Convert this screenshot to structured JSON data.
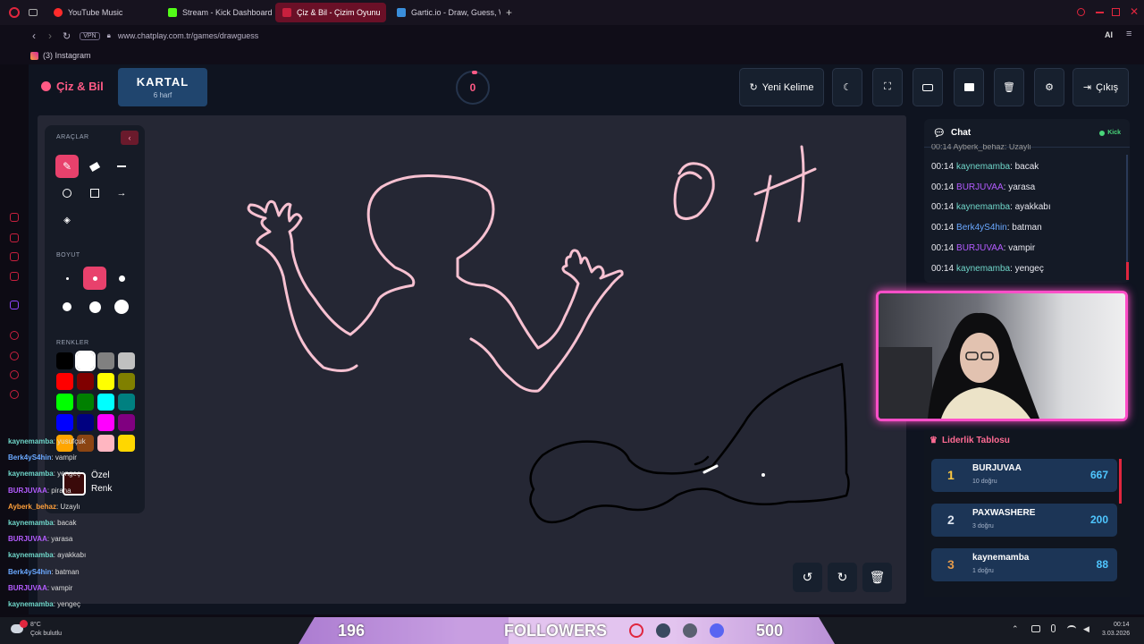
{
  "browser": {
    "tabs": [
      {
        "label": "YouTube Music",
        "color": "#ff2b2b"
      },
      {
        "label": "Stream - Kick Dashboard",
        "color": "#53fc18"
      },
      {
        "label": "Çiz & Bil - Çizim Oyunu",
        "color": "#c8203e"
      },
      {
        "label": "Gartic.io - Draw, Guess, W",
        "color": "#3a8edb"
      }
    ],
    "vpn": "VPN",
    "url": "www.chatplay.com.tr/games/drawguess",
    "bookmark": "(3) Instagram",
    "ai_label": "AI"
  },
  "app": {
    "logo": "Çiz & Bil",
    "word": "KARTAL",
    "word_hint": "6 harf",
    "timer": "0",
    "buttons": {
      "new_word": "Yeni Kelime",
      "exit": "Çıkış"
    }
  },
  "tools": {
    "section_tools": "ARAÇLAR",
    "section_size": "BOYUT",
    "section_colors": "RENKLER",
    "custom_color": "Özel",
    "custom_color2": "Renk",
    "colors": [
      "#000000",
      "#ffffff",
      "#808080",
      "#c0c0c0",
      "#ff0000",
      "#800000",
      "#ffff00",
      "#808000",
      "#00ff00",
      "#008000",
      "#00ffff",
      "#008080",
      "#0000ff",
      "#000080",
      "#ff00ff",
      "#800080",
      "#ffa500",
      "#8b4513",
      "#ffb6c1",
      "#ffd700"
    ]
  },
  "chat": {
    "title": "Chat",
    "badge": "Kick",
    "partial": "00:14 Ayberk_behaz: Uzaylı",
    "messages": [
      {
        "time": "00:14",
        "user": "kaynemamba",
        "text": "bacak",
        "color": "#6fd6c9"
      },
      {
        "time": "00:14",
        "user": "BURJUVAA",
        "text": "yarasa",
        "color": "#b45cff"
      },
      {
        "time": "00:14",
        "user": "kaynemamba",
        "text": "ayakkabı",
        "color": "#6fd6c9"
      },
      {
        "time": "00:14",
        "user": "Berk4yS4hin",
        "text": "batman",
        "color": "#6aa8ff"
      },
      {
        "time": "00:14",
        "user": "BURJUVAA",
        "text": "vampir",
        "color": "#b45cff"
      },
      {
        "time": "00:14",
        "user": "kaynemamba",
        "text": "yengeç",
        "color": "#6fd6c9"
      }
    ]
  },
  "leaderboard": {
    "title": "Liderlik Tablosu",
    "rows": [
      {
        "rank": "1",
        "name": "BURJUVAA",
        "correct": "10 doğru",
        "points": "667",
        "rank_color": "#ffc940"
      },
      {
        "rank": "2",
        "name": "PAXWASHERE",
        "correct": "3 doğru",
        "points": "200",
        "rank_color": "#dfe6f0"
      },
      {
        "rank": "3",
        "name": "kaynemamba",
        "correct": "1 doğru",
        "points": "88",
        "rank_color": "#e39a4b"
      }
    ]
  },
  "overlay_chat": [
    {
      "user": "kaynemamba",
      "text": ": yusufçuk",
      "color": "#6fd6c9"
    },
    {
      "user": "Berk4yS4hin",
      "text": ": vampir",
      "color": "#6aa8ff"
    },
    {
      "user": "kaynemamba",
      "text": ": yengeç",
      "color": "#6fd6c9"
    },
    {
      "user": "BURJUVAA",
      "text": ": pirana",
      "color": "#b45cff"
    },
    {
      "user": "Ayberk_behaz",
      "text": ": Uzaylı",
      "color": "#ff9f3a"
    },
    {
      "user": "kaynemamba",
      "text": ": bacak",
      "color": "#6fd6c9"
    },
    {
      "user": "BURJUVAA",
      "text": ": yarasa",
      "color": "#b45cff"
    },
    {
      "user": "kaynemamba",
      "text": ": ayakkabı",
      "color": "#6fd6c9"
    },
    {
      "user": "Berk4yS4hin",
      "text": ": batman",
      "color": "#6aa8ff"
    },
    {
      "user": "BURJUVAA",
      "text": ": vampir",
      "color": "#b45cff"
    },
    {
      "user": "kaynemamba",
      "text": ": yengeç",
      "color": "#6fd6c9"
    }
  ],
  "followers": {
    "current": "196",
    "label": "FOLLOWERS",
    "goal": "500",
    "progress_fraction": 0.392
  },
  "taskbar": {
    "temp": "8°C",
    "weather": "Çok bulutlu",
    "time": "00:14",
    "date": "3.03.2026"
  }
}
